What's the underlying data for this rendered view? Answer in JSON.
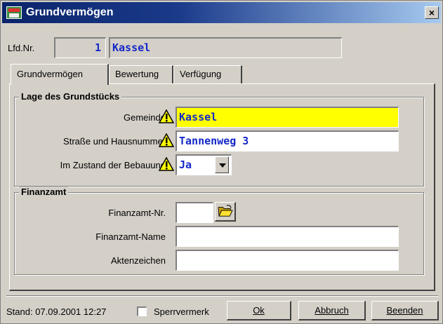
{
  "window": {
    "title": "Grundvermögen",
    "close_glyph": "×"
  },
  "header": {
    "lfd_label": "Lfd.Nr.",
    "lfd_value": "1",
    "name_value": "Kassel"
  },
  "tabs": [
    {
      "label": "Grundvermögen",
      "active": true
    },
    {
      "label": "Bewertung",
      "active": false
    },
    {
      "label": "Verfügung",
      "active": false
    }
  ],
  "lage": {
    "title": "Lage des Grundstücks",
    "gemeinde_label": "Gemeinde",
    "gemeinde_value": "Kassel",
    "strasse_label": "Straße und Hausnummer",
    "strasse_value": "Tannenweg 3",
    "zustand_label": "Im Zustand der Bebauung",
    "zustand_value": "Ja",
    "warning_icon": "warning-triangle"
  },
  "finanzamt": {
    "title": "Finanzamt",
    "nr_label": "Finanzamt-Nr.",
    "nr_value": "",
    "name_label": "Finanzamt-Name",
    "name_value": "",
    "akten_label": "Aktenzeichen",
    "akten_value": ""
  },
  "footer": {
    "stand": "Stand: 07.09.2001 12:27",
    "sperrvermerk_label": "Sperrvermerk",
    "sperrvermerk_checked": false,
    "ok_label": "Ok",
    "abbruch_label": "Abbruch",
    "beenden_label": "Beenden"
  },
  "colors": {
    "required_field": "#ffff00",
    "field_text": "#1428c8",
    "title_bar": "#0a246a"
  }
}
